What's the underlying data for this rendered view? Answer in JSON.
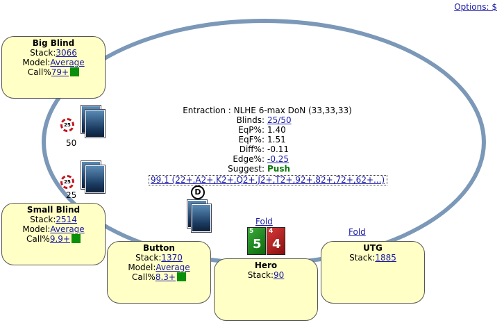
{
  "options_link": "Options: $",
  "info": {
    "title": "Entraction : NLHE 6-max DoN (33,33,33)",
    "rows": {
      "blinds": {
        "label": "Blinds:",
        "value": "25/50"
      },
      "eqp": {
        "label": "EqP%:",
        "value": "1.40"
      },
      "eqf": {
        "label": "EqF%:",
        "value": "1.51"
      },
      "diff": {
        "label": "Diff%:",
        "value": "-0.11"
      },
      "edge": {
        "label": "Edge%:",
        "value": "-0.25"
      },
      "suggest": {
        "label": "Suggest:",
        "value": "Push"
      }
    },
    "range": "99.1 (22+,A2+,K2+,Q2+,J2+,T2+,92+,82+,72+,62+...)"
  },
  "seats": {
    "big_blind": {
      "name": "Big Blind",
      "stack_label": "Stack:",
      "stack": "3066",
      "model_label": "Model:",
      "model": "Average",
      "call_label": "Call%",
      "call": "79+"
    },
    "small_blind": {
      "name": "Small Blind",
      "stack_label": "Stack:",
      "stack": "2514",
      "model_label": "Model:",
      "model": "Average",
      "call_label": "Call%",
      "call": "9.9+"
    },
    "button": {
      "name": "Button",
      "stack_label": "Stack:",
      "stack": "1370",
      "model_label": "Model:",
      "model": "Average",
      "call_label": "Call%",
      "call": "8.3+"
    },
    "hero": {
      "name": "Hero",
      "stack_label": "Stack:",
      "stack": "90"
    },
    "utg": {
      "name": "UTG",
      "stack_label": "Stack:",
      "stack": "1885"
    }
  },
  "bets": {
    "big_blind": "50",
    "small_blind": "25"
  },
  "chip_label": "25",
  "dealer_label": "D",
  "fold_hero": "Fold",
  "fold_utg": "Fold",
  "hero_cards": [
    {
      "rank": "5",
      "suit": "♣",
      "color": "#1f8f1f"
    },
    {
      "rank": "4",
      "suit": "♥",
      "color": "#b71c1c"
    }
  ],
  "call_indicator_color": "#0a8f0a"
}
